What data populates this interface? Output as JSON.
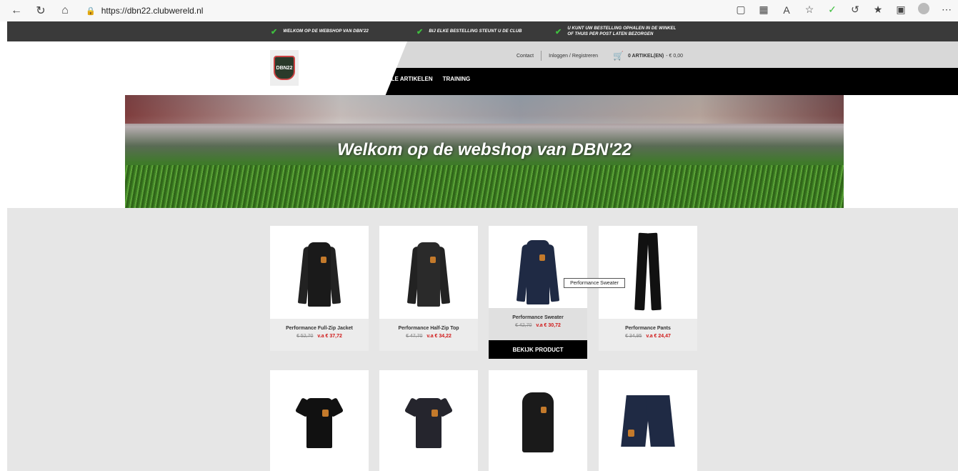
{
  "browser": {
    "url": "https://dbn22.clubwereld.nl"
  },
  "topbar": {
    "usps": [
      "WELKOM OP DE WEBSHOP VAN DBN'22",
      "BIJ ELKE BESTELLING STEUNT U DE CLUB",
      "U KUNT UW BESTELLING OPHALEN IN DE WINKEL",
      "OF THUIS PER POST LATEN BEZORGEN"
    ]
  },
  "header": {
    "logo_text": "DBN22",
    "links": {
      "contact": "Contact",
      "login": "Inloggen / Registreren",
      "cart": "0 ARTIKEL(EN)",
      "cart_total": "- € 0,00"
    },
    "menu": [
      "ALLE ARTIKELEN",
      "TRAINING"
    ]
  },
  "banner": {
    "title": "Welkom op de webshop van DBN'22"
  },
  "products": [
    {
      "name": "Performance Full-Zip Jacket",
      "old_price": "€ 52,70",
      "new_price": "v.a € 37,72"
    },
    {
      "name": "Performance Half-Zip Top",
      "old_price": "€ 47,70",
      "new_price": "v.a € 34,22"
    },
    {
      "name": "Performance Sweater",
      "old_price": "€ 42,70",
      "new_price": "v.a € 30,72",
      "button": "BEKIJK PRODUCT"
    },
    {
      "name": "Performance Pants",
      "old_price": "€ 34,95",
      "new_price": "v.a € 24,47"
    }
  ],
  "tooltip": "Performance Sweater",
  "colors": {
    "topbar": "#3a3a3a",
    "check": "#3fbf3f",
    "sale": "#d01818",
    "menu_bg": "#000000"
  }
}
